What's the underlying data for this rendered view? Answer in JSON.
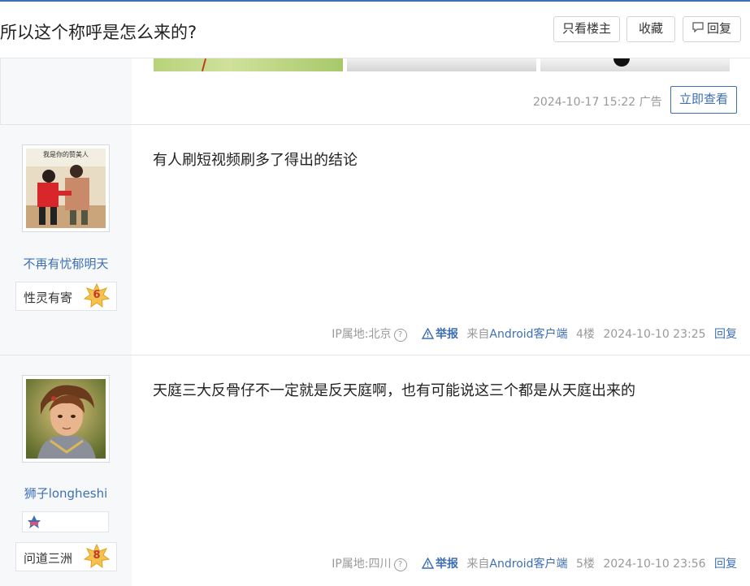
{
  "header": {
    "title": "所以这个称呼是怎么来的?",
    "only_op_label": "只看楼主",
    "favorite_label": "收藏",
    "reply_label": "回复"
  },
  "ad": {
    "time": "2024-10-17 15:22",
    "tag": "广告",
    "button_label": "立即查看"
  },
  "posts": [
    {
      "username": "不再有忧郁明天",
      "level_title": "性灵有寄",
      "level_num": "6",
      "avatar_caption": "我是你的赞美人",
      "content": "有人刷短视频刷多了得出的结论",
      "ip": "IP属地:北京",
      "report": "举报",
      "from_prefix": "来自",
      "client": "Android客户端",
      "floor": "4楼",
      "time": "2024-10-10 23:25",
      "reply": "回复"
    },
    {
      "username": "狮子longheshi",
      "level_title": "问道三洲",
      "level_num": "8",
      "content": "天庭三大反骨仔不一定就是反天庭啊，也有可能说这三个都是从天庭出来的",
      "ip": "IP属地:四川",
      "report": "举报",
      "from_prefix": "来自",
      "client": "Android客户端",
      "floor": "5楼",
      "time": "2024-10-10 23:56",
      "reply": "回复"
    }
  ],
  "colors": {
    "accent": "#3d6fb5",
    "muted": "#999999",
    "sidebar_bg": "#f7f8fa"
  }
}
